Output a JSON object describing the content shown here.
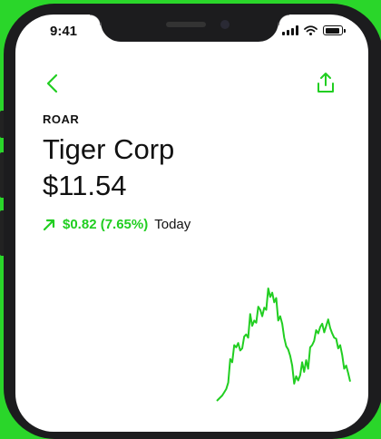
{
  "status_bar": {
    "time": "9:41"
  },
  "header": {
    "back_icon": "chevron-left-icon",
    "share_icon": "share-icon"
  },
  "stock": {
    "ticker": "ROAR",
    "name": "Tiger Corp",
    "price": "$11.54",
    "change": "$0.82 (7.65%)",
    "period": "Today",
    "direction_icon": "arrow-up-right-icon"
  },
  "colors": {
    "accent": "#21ce21",
    "background": "#2ad62a"
  },
  "chart_data": {
    "type": "line",
    "values": [
      0,
      3,
      6,
      12,
      34,
      31,
      47,
      45,
      49,
      42,
      44,
      55,
      57,
      54,
      76,
      65,
      70,
      68,
      83,
      80,
      74,
      82,
      80,
      100,
      92,
      96,
      87,
      91,
      70,
      74,
      67,
      54,
      46,
      43,
      37,
      28,
      11,
      18,
      14,
      19,
      31,
      22,
      33,
      25,
      45,
      47,
      51,
      61,
      58,
      64,
      67,
      59,
      65,
      71,
      63,
      58,
      54,
      53,
      44,
      47,
      38,
      25,
      28,
      21,
      13
    ]
  }
}
